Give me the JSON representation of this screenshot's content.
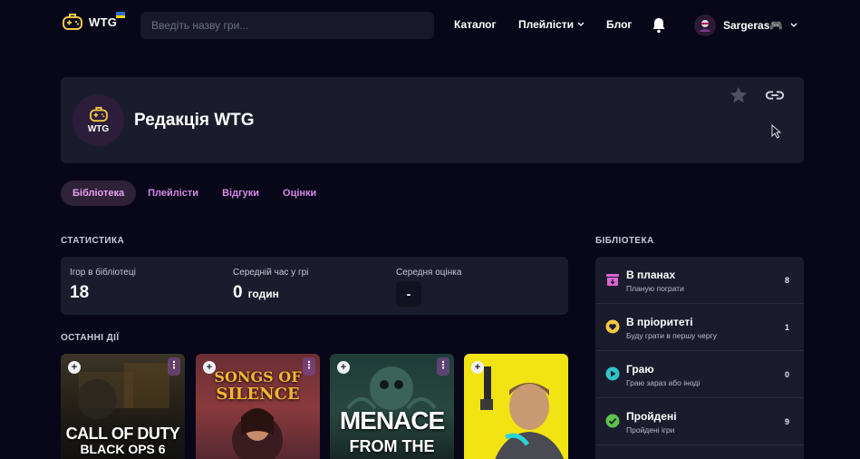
{
  "header": {
    "logo_text": "WTG",
    "search_placeholder": "Введіть назву гри...",
    "nav": {
      "catalog": "Каталог",
      "playlists": "Плейлісти",
      "blog": "Блог"
    },
    "username": "Sargeras🎮"
  },
  "profile": {
    "name": "Редакція WTG",
    "avatar_text": "WTG"
  },
  "tabs": [
    "Бібліотека",
    "Плейлісти",
    "Відгуки",
    "Оцінки"
  ],
  "stats": {
    "title": "СТАТИСТИКА",
    "games_label": "Ігор в бібліотеці",
    "games_value": "18",
    "avg_time_label": "Середній час у грі",
    "avg_time_value": "0",
    "avg_time_unit": "годин",
    "avg_rating_label": "Середня оцінка",
    "avg_rating_value": "-"
  },
  "recent": {
    "title": "ОСТАННІ ДІЇ",
    "games": [
      {
        "title_line1": "CALL OF DUTY",
        "title_line2": "BLACK OPS 6"
      },
      {
        "title_line1": "SONGS OF",
        "title_line2": "SILENCE"
      },
      {
        "title_line1": "MENACE",
        "title_line2": "FROM THE"
      },
      {
        "title_line1": "",
        "title_line2": ""
      }
    ]
  },
  "library": {
    "title": "БІБЛІОТЕКА",
    "items": [
      {
        "name": "В планах",
        "sub": "Планую пограти",
        "count": "8"
      },
      {
        "name": "В пріоритеті",
        "sub": "Буду грати в першу чергу",
        "count": "1"
      },
      {
        "name": "Граю",
        "sub": "Граю зараз або іноді",
        "count": "0"
      },
      {
        "name": "Пройдені",
        "sub": "Пройдені ігри",
        "count": "9"
      }
    ]
  },
  "colors": {
    "background": "#070719",
    "card": "#1a1c2d",
    "accent": "#d78ae6",
    "gold": "#f2c744"
  }
}
